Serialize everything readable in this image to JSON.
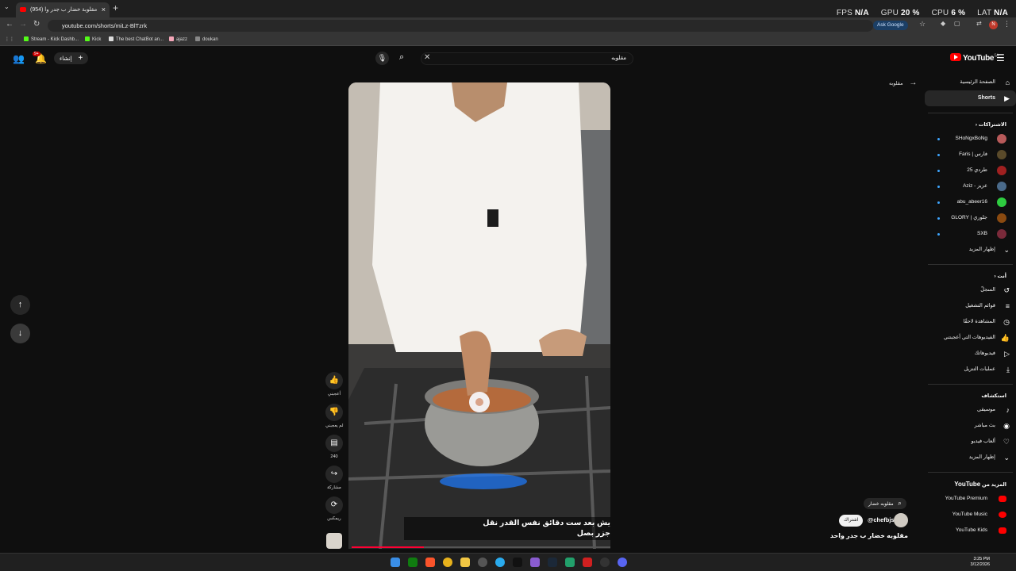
{
  "browser": {
    "tab_title": "مقلوبة خضار ب جدر وا (954)",
    "new_tab": "+",
    "url": "youtube.com/shorts/miLz-BlTzrk",
    "ask_google": "Ask Google",
    "bookmarks": [
      {
        "label": "Stream - Kick Dashb...",
        "color": "#53fc18"
      },
      {
        "label": "Kick",
        "color": "#53fc18"
      },
      {
        "label": "The best ChatBot an...",
        "color": "#dddddd"
      },
      {
        "label": "ajazz",
        "color": "#f4a6b8"
      },
      {
        "label": "doukan",
        "color": "#888888"
      }
    ],
    "perf": {
      "fps_label": "FPS",
      "fps": "N/A",
      "gpu_label": "GPU",
      "gpu": "20 %",
      "cpu_label": "CPU",
      "cpu": "6 %",
      "lat_label": "LAT",
      "lat": "N/A"
    }
  },
  "topbar": {
    "create_label": "إنشاء",
    "notif_badge": "9+",
    "search_value": "مقلوبه",
    "logo_text": "YouTube",
    "logo_region": "SA"
  },
  "video": {
    "caption_line1": "يش بعد ست دقائق نفس القدر نقل",
    "caption_line2": "جزر بصل",
    "progress": 0.28
  },
  "actions": {
    "like_label": "أعجبني",
    "dislike_label": "لم يعجبني",
    "comments_count": "240",
    "share_label": "مشاركة",
    "remix_label": "ريمكس"
  },
  "shorts_info": {
    "back_label": "مقلوبه",
    "search_chip": "مقلوبه خضار",
    "subscribe_label": "اشتراك",
    "channel_name": "@chefbjs",
    "video_title": "مقلوبه خضار ب جدر واحد"
  },
  "sidebar": {
    "home": "الصفحة الرئيسية",
    "shorts": "Shorts",
    "subs_header": "الاشتراكات",
    "subscriptions": [
      {
        "name": "SHoNgxBoNg",
        "color": "#b85a5a"
      },
      {
        "name": "فارس | Faris",
        "color": "#5a4a2a"
      },
      {
        "name": "طردي 25",
        "color": "#a02020"
      },
      {
        "name": "عزيز - Aziz",
        "color": "#4a6a8a"
      },
      {
        "name": "abu_abeer16",
        "color": "#2ecc40"
      },
      {
        "name": "جلوري | GLORY",
        "color": "#8a4a10"
      },
      {
        "name": "SXB",
        "color": "#7a2a3a"
      }
    ],
    "show_more": "إظهار المزيد",
    "you_header": "أنت",
    "you_items": [
      "السجلّ",
      "قوائم التشغيل",
      "المشاهدة لاحقًا",
      "الفيديوهات التي أعجبتني",
      "فيديوهاتك",
      "عمليات التنزيل"
    ],
    "explore_header": "استكشاف",
    "explore_items": [
      "موسيقى",
      "بث مباشر",
      "ألعاب فيديو",
      "إظهار المزيد"
    ],
    "more_header_prefix": "المزيد من",
    "more_header_brand": "YouTube",
    "more_items": [
      "YouTube Premium",
      "YouTube Music",
      "YouTube Kids"
    ]
  },
  "taskbar": {
    "time": "3:25 PM",
    "date": "3/12/2026"
  }
}
